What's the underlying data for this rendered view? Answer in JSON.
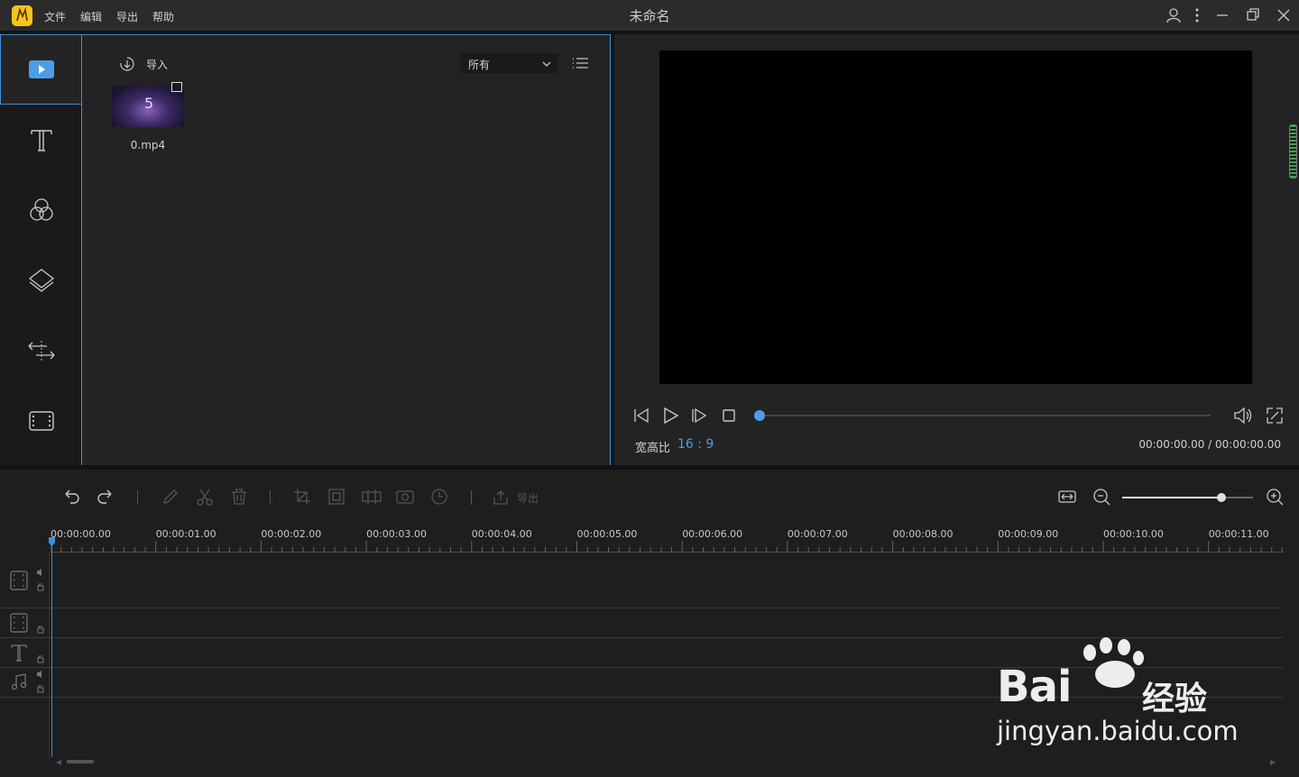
{
  "titlebar": {
    "menu": [
      "文件",
      "编辑",
      "导出",
      "帮助"
    ],
    "title": "未命名"
  },
  "media_panel": {
    "import_label": "导入",
    "filter_value": "所有",
    "items": [
      {
        "name": "0.mp4",
        "thumb_text": "5"
      }
    ]
  },
  "preview": {
    "aspect_label": "宽高比",
    "aspect_value": "16 : 9",
    "time_readout": "00:00:00.00 / 00:00:00.00",
    "progress": 0
  },
  "timeline": {
    "export_label": "导出",
    "zoom_level": 0.76,
    "ruler_labels": [
      "00:00:00.00",
      "00:00:01.00",
      "00:00:02.00",
      "00:00:03.00",
      "00:00:04.00",
      "00:00:05.00",
      "00:00:06.00",
      "00:00:07.00",
      "00:00:08.00",
      "00:00:09.00",
      "00:00:10.00",
      "00:00:11.00"
    ]
  },
  "watermark": {
    "brand": "Bai",
    "brand_suffix": "经验",
    "url": "jingyan.baidu.com"
  },
  "colors": {
    "accent": "#3f8fd8",
    "background": "#1e1e1e",
    "panel": "#232323",
    "logo": "#f5c518"
  }
}
